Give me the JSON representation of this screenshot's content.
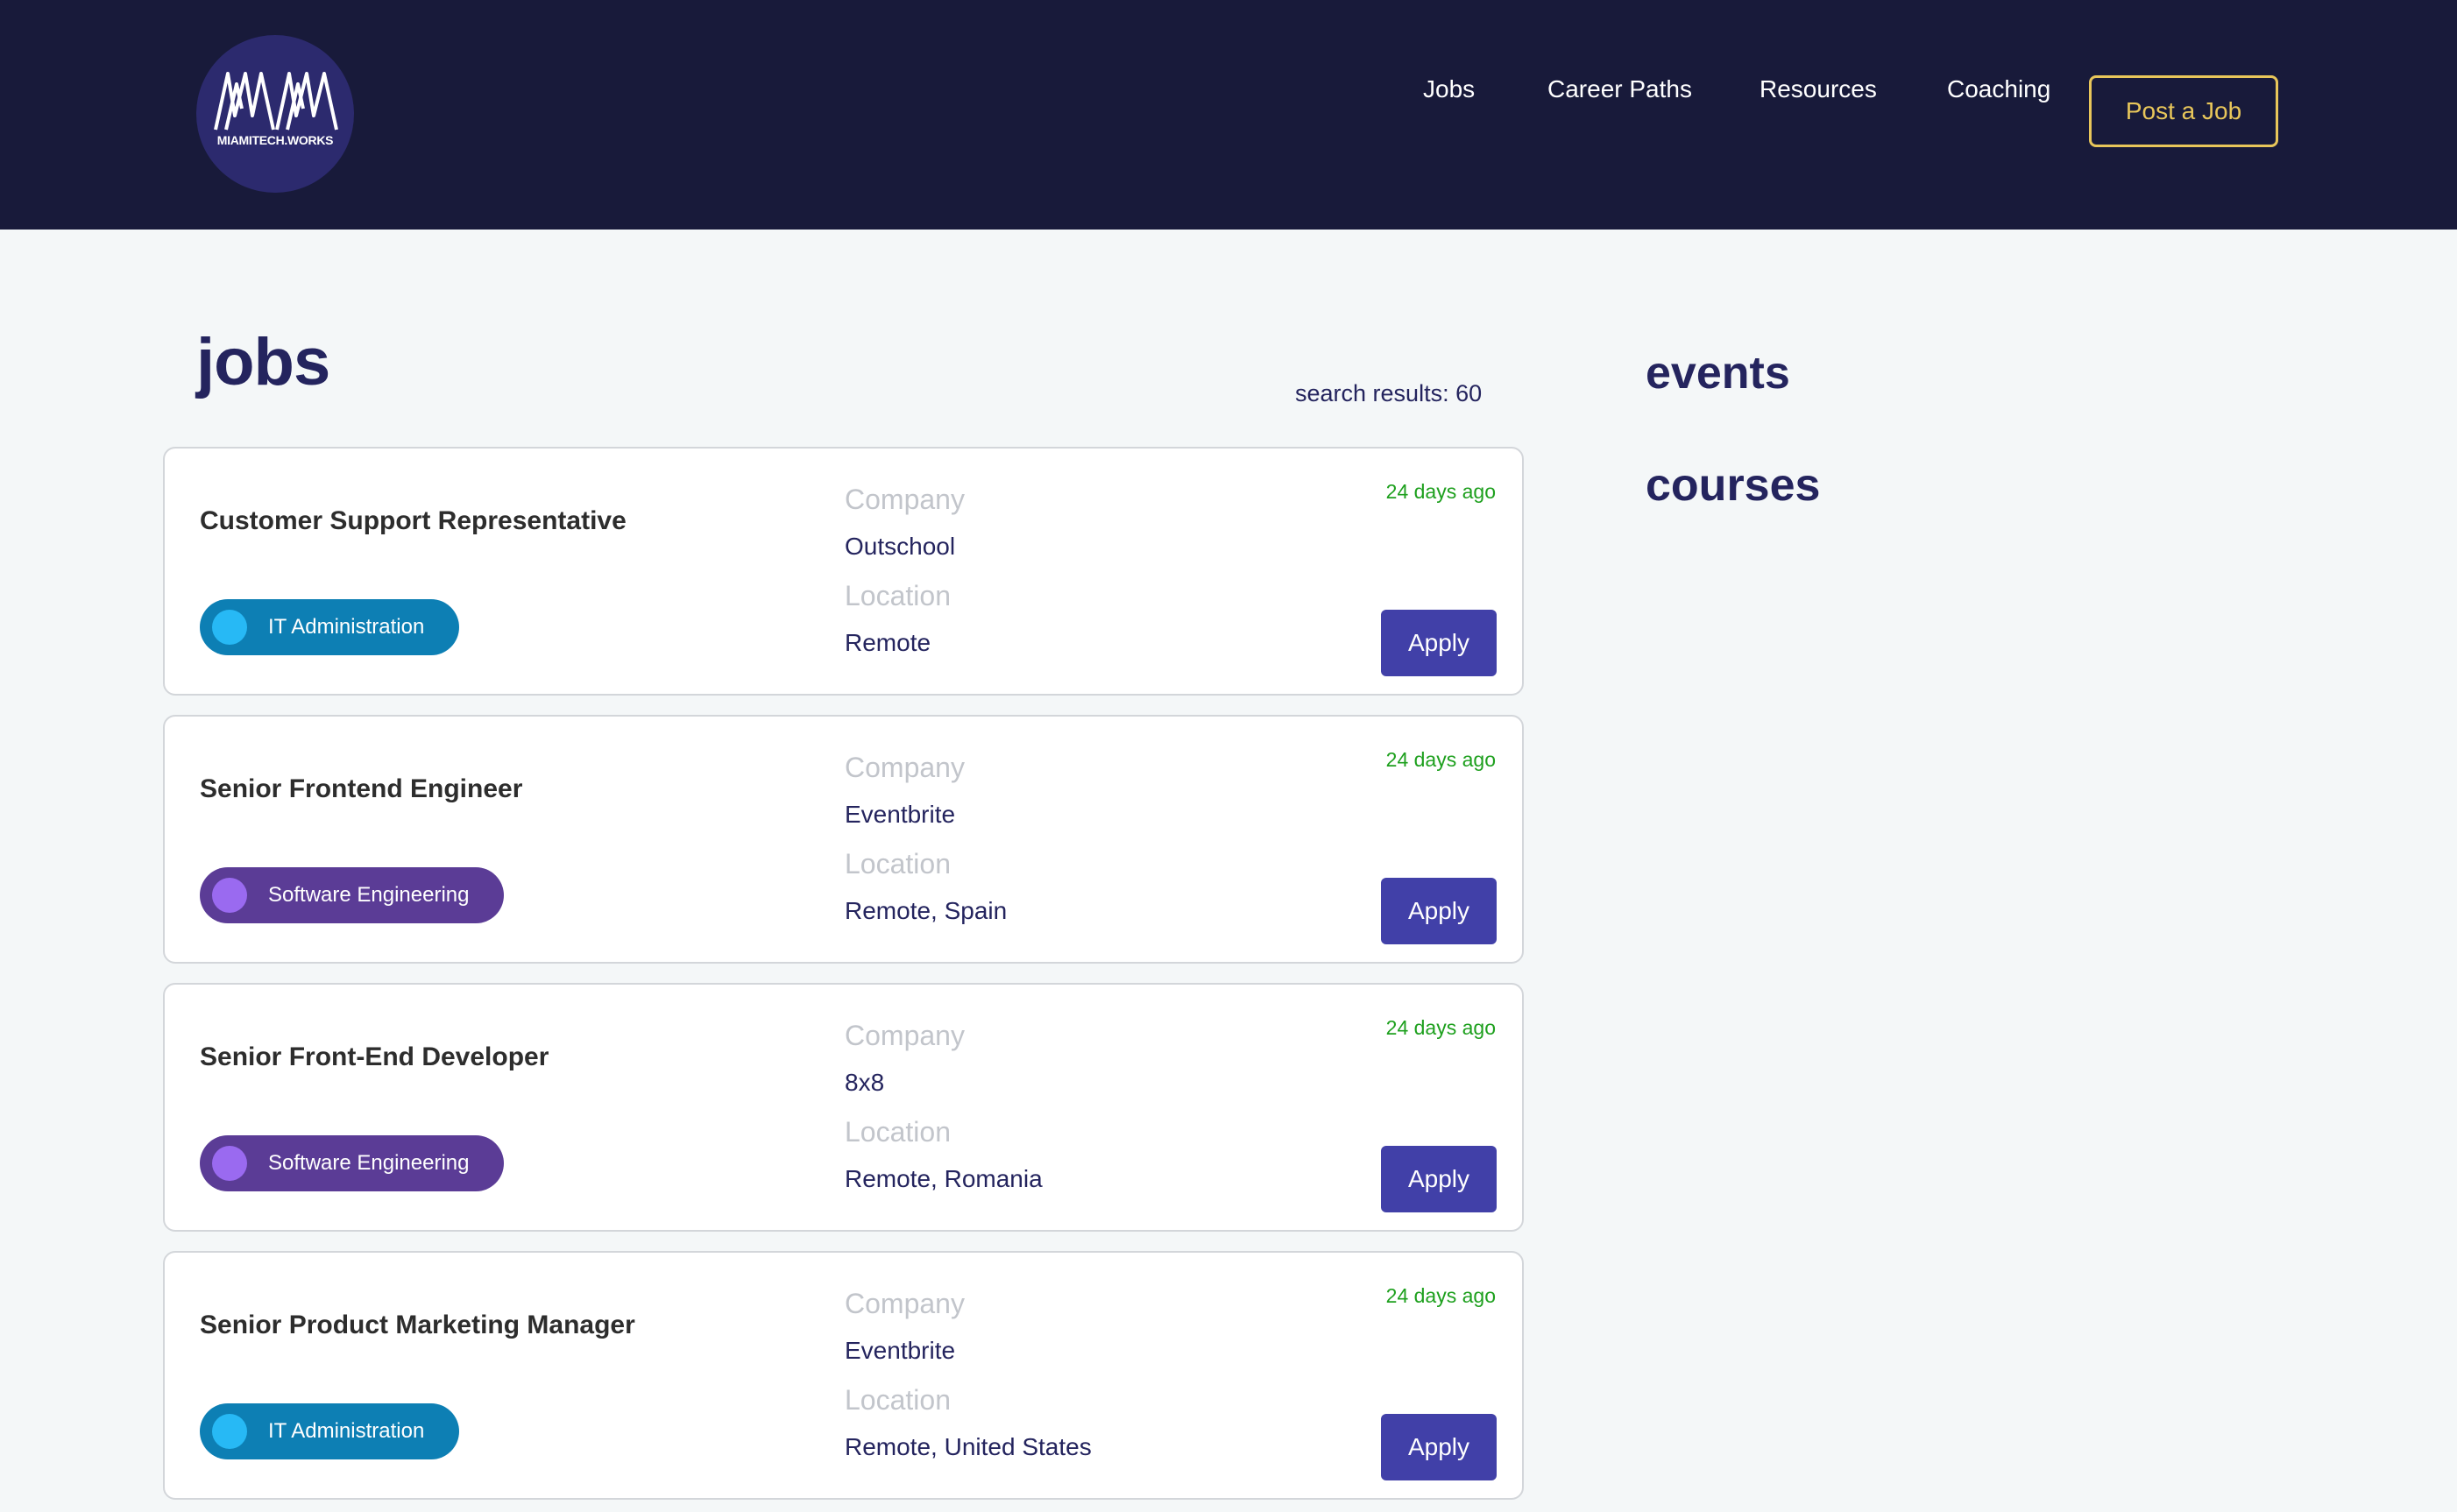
{
  "header": {
    "logo_text": "MIAMITECH.WORKS",
    "nav": [
      "Jobs",
      "Career Paths",
      "Resources",
      "Coaching"
    ],
    "post_job_label": "Post a Job"
  },
  "colors": {
    "header_bg": "#181a3a",
    "accent_yellow": "#e8c65a",
    "apply_button": "#4140a8",
    "it_tag": "#0d7fb4",
    "it_dot": "#27b9f5",
    "se_tag": "#5b3c96",
    "se_dot": "#9a6af0",
    "posted_green": "#1ea01e"
  },
  "main": {
    "title": "jobs",
    "search_results": "search results: 60",
    "company_label": "Company",
    "location_label": "Location",
    "apply_label": "Apply",
    "jobs": [
      {
        "title": "Customer Support Representative",
        "tag": "IT Administration",
        "company": "Outschool",
        "location": "Remote",
        "posted": "24 days ago"
      },
      {
        "title": "Senior Frontend Engineer",
        "tag": "Software Engineering",
        "company": "Eventbrite",
        "location": "Remote, Spain",
        "posted": "24 days ago"
      },
      {
        "title": "Senior Front-End Developer",
        "tag": "Software Engineering",
        "company": "8x8",
        "location": "Remote, Romania",
        "posted": "24 days ago"
      },
      {
        "title": "Senior Product Marketing Manager",
        "tag": "IT Administration",
        "company": "Eventbrite",
        "location": "Remote, United States",
        "posted": "24 days ago"
      }
    ]
  },
  "sidebar": {
    "events_title": "events",
    "courses_title": "courses"
  }
}
